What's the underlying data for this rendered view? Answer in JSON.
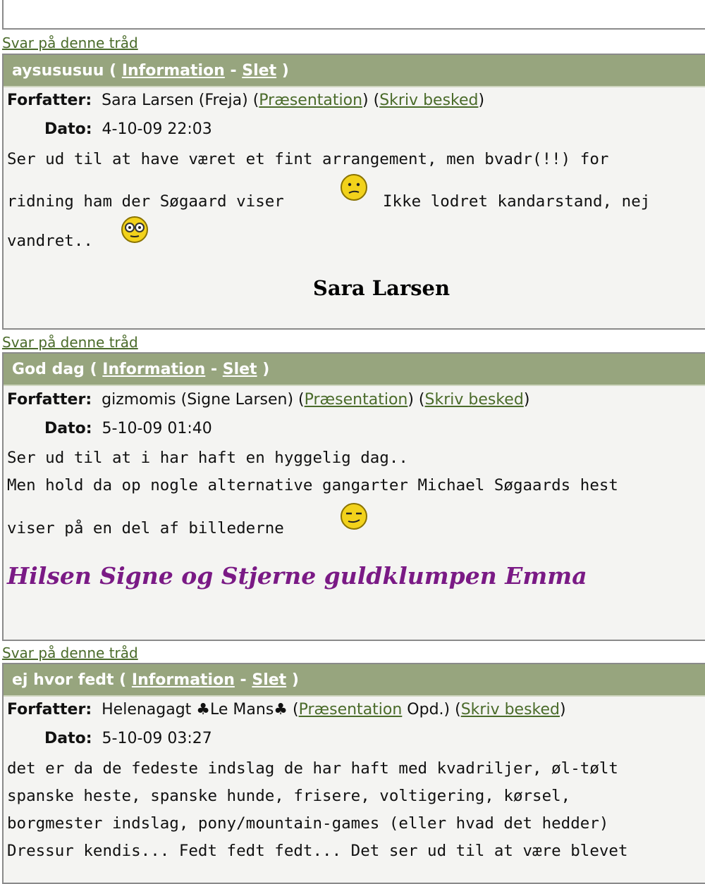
{
  "reply_label": "Svar på denne tråd",
  "labels": {
    "author": "Forfatter:",
    "date": "Dato:",
    "information": "Information",
    "delete": "Slet",
    "presentation": "Præsentation",
    "write_message": "Skriv besked"
  },
  "posts": [
    {
      "title": "aysususuu",
      "author_pre": "Sara Larsen (Freja) (",
      "author_mid": ") (",
      "author_post": ")",
      "date": "4-10-09 22:03",
      "body": [
        "Ser ud til at have været et fint arrangement, men bvadr(!!) for",
        "ridning ham der Søgaard viser",
        "Ikke lodret kandarstand, nej",
        "vandret.."
      ],
      "emoticons": [
        "confused-face-icon",
        "glasses-face-icon"
      ],
      "signature": "Sara Larsen"
    },
    {
      "title": "God dag",
      "author_pre": "gizmomis (Signe Larsen) (",
      "author_mid": ") (",
      "author_post": ")",
      "date": "5-10-09 01:40",
      "body": [
        "Ser ud til at i har haft en hyggelig dag..",
        "Men hold da op nogle alternative gangarter Michael Søgaards hest",
        "viser på en del af billederne"
      ],
      "emoticons": [
        "smirk-face-icon"
      ],
      "signature": "Hilsen Signe og Stjerne guldklumpen Emma"
    },
    {
      "title": "ej hvor fedt",
      "author_pre": "Helenagagt ♣Le Mans♣ (",
      "author_mid": " Opd.) (",
      "author_post": ")",
      "date": "5-10-09 03:27",
      "body": [
        "det er da de fedeste indslag de har haft med kvadriljer, øl-tølt",
        "spanske heste, spanske hunde, frisere, voltigering, kørsel,",
        "borgmester indslag, pony/mountain-games (eller hvad det hedder)",
        "Dressur kendis... Fedt fedt fedt... Det ser ud til at være blevet"
      ]
    }
  ],
  "colors": {
    "header_bg": "#97a57e",
    "link": "#4a6b2a",
    "signature2": "#7a1a85"
  }
}
